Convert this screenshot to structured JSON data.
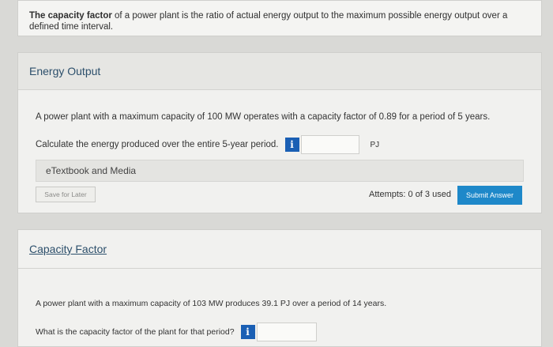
{
  "intro": {
    "bold_term": "The capacity factor",
    "rest": " of a power plant is the ratio of actual energy output to the maximum possible energy output over a defined time interval."
  },
  "section1": {
    "title": "Energy Output",
    "problem": "A power plant with a maximum capacity of 100 MW operates with a capacity factor of 0.89 for a period of 5 years.",
    "question": "Calculate the energy produced over the entire 5-year period.",
    "info_icon": "i",
    "answer_value": "",
    "unit": "PJ",
    "etextbook": "eTextbook and Media",
    "save_label": "Save for Later",
    "attempts": "Attempts: 0 of 3 used",
    "submit_label": "Submit Answer"
  },
  "section2": {
    "title": "Capacity Factor",
    "problem": "A power plant with a maximum capacity of 103 MW produces 39.1 PJ over a period of 14 years.",
    "question": "What is the capacity factor of the plant for that period?",
    "info_icon": "i",
    "answer_value": ""
  },
  "colors": {
    "accent": "#1e88c9",
    "info": "#1a5fb4",
    "heading": "#2c4f6b"
  }
}
